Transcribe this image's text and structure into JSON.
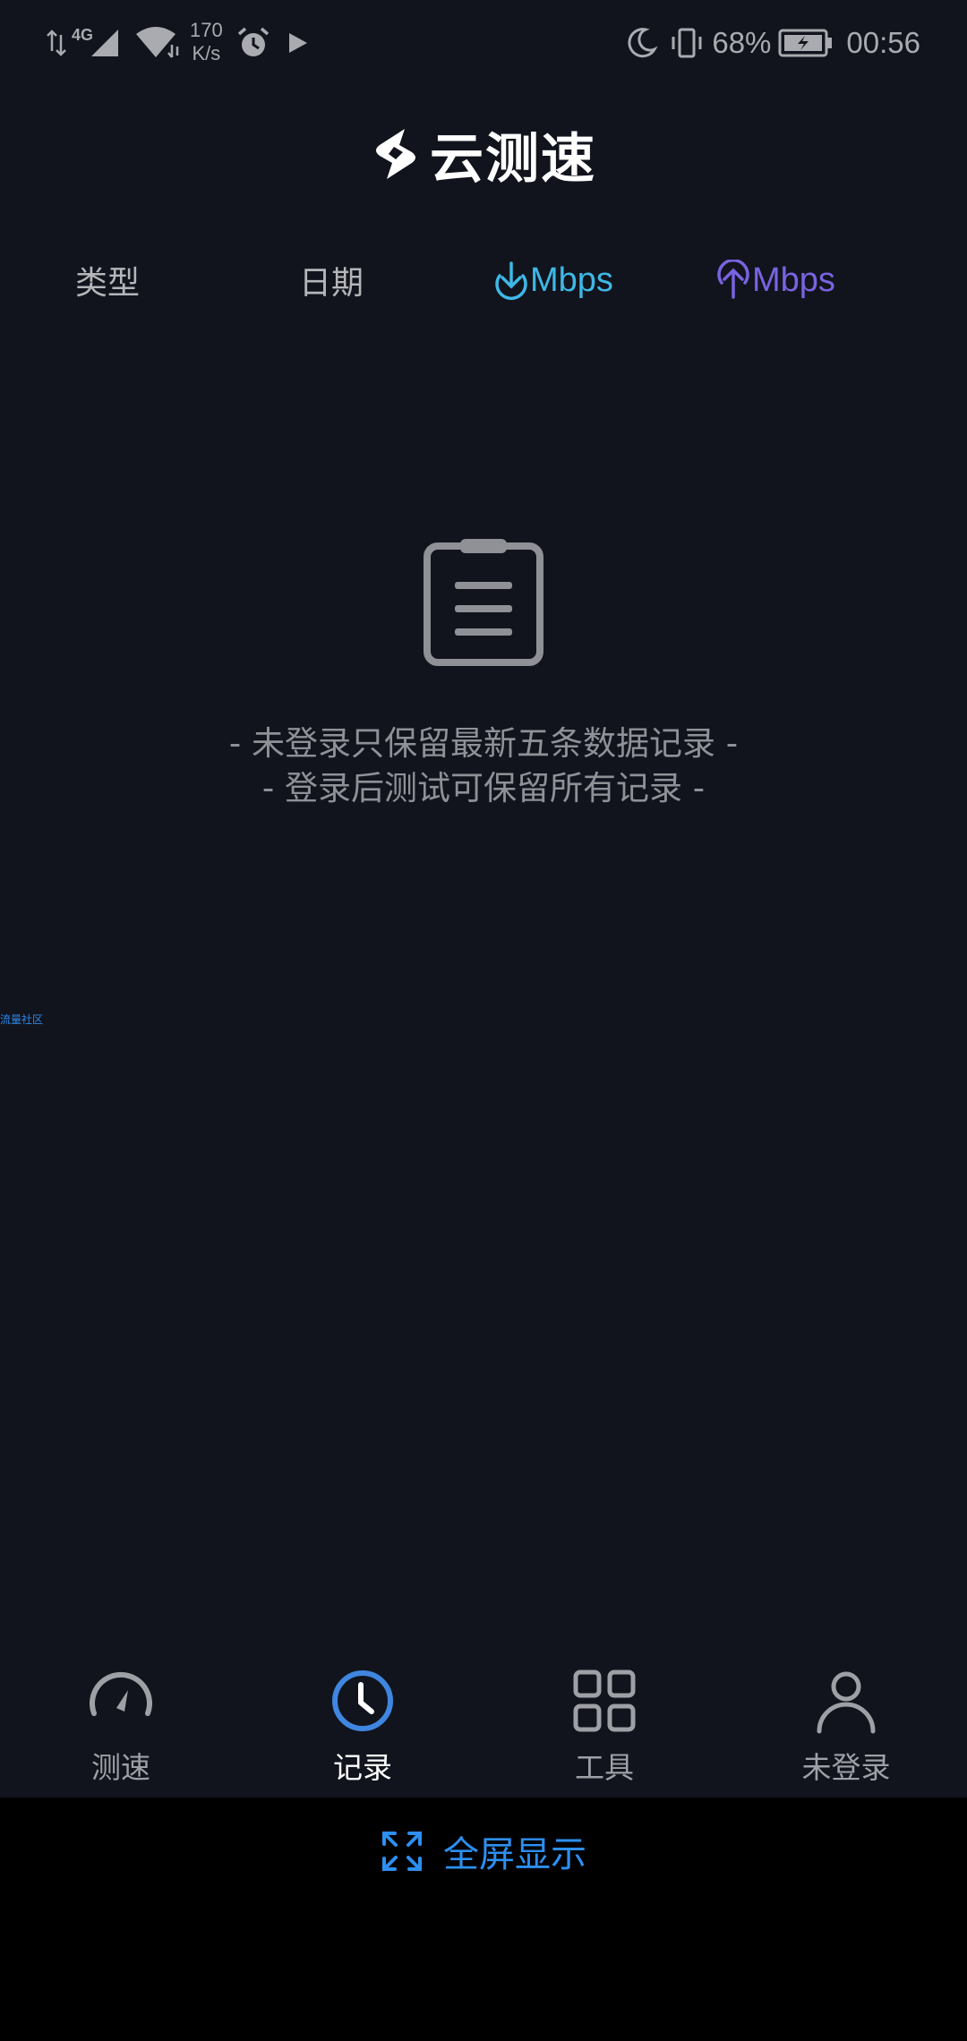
{
  "status_bar": {
    "network_type": "4G",
    "net_speed_value": "170",
    "net_speed_unit": "K/s",
    "battery": "68%",
    "time": "00:56"
  },
  "logo": {
    "text": "云测速"
  },
  "columns": {
    "type": "类型",
    "date": "日期",
    "download": "Mbps",
    "upload": "Mbps"
  },
  "empty_state": {
    "line1": "- 未登录只保留最新五条数据记录 -",
    "line2": "- 登录后测试可保留所有记录 -"
  },
  "side_link": "流量社区",
  "tabs": [
    {
      "label": "测速",
      "icon": "speedometer-icon"
    },
    {
      "label": "记录",
      "icon": "clock-icon"
    },
    {
      "label": "工具",
      "icon": "grid-icon"
    },
    {
      "label": "未登录",
      "icon": "user-icon"
    }
  ],
  "active_tab": "记录",
  "fullscreen": {
    "label": "全屏显示"
  },
  "colors": {
    "background": "#11141d",
    "download": "#3fb8e6",
    "upload": "#7963e0",
    "active_tab": "#3f86e0",
    "fullscreen": "#2d8ff0"
  }
}
